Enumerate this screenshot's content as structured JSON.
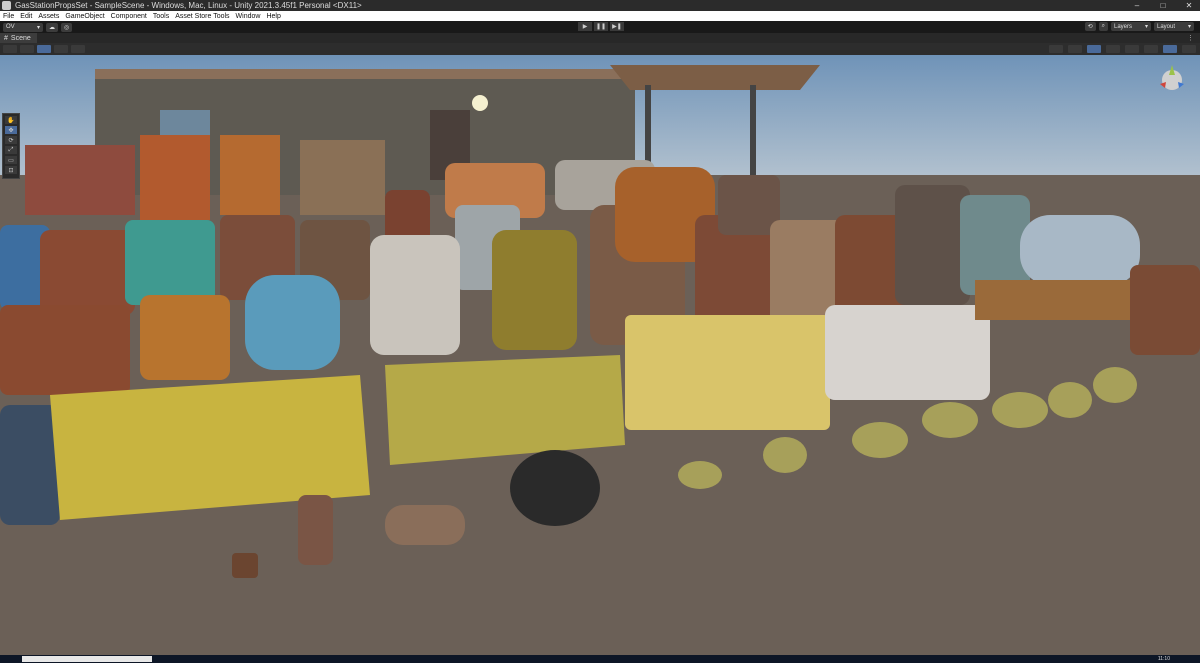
{
  "window": {
    "title": "GasStationPropsSet - SampleScene - Windows, Mac, Linux - Unity 2021.3.45f1 Personal <DX11>",
    "controls": [
      "–",
      "□",
      "✕"
    ]
  },
  "menu": [
    "File",
    "Edit",
    "Assets",
    "GameObject",
    "Component",
    "Tools",
    "Asset Store Tools",
    "Window",
    "Help"
  ],
  "toolbar": {
    "account_label": "OV",
    "play_icons": [
      "▶",
      "❚❚",
      "▶❚"
    ],
    "layers_label": "Layers",
    "layout_label": "Layout"
  },
  "tabs": {
    "scene_label": "Scene",
    "more": "⋮"
  },
  "tools": [
    "✋",
    "✥",
    "⟳",
    "⤢",
    "▭",
    "⊡"
  ],
  "taskbar": {
    "time": "11:10"
  },
  "colors": {
    "sky_top": "#7f9ebd",
    "ground": "#6b6057",
    "accent_active": "#4a6a9a"
  }
}
